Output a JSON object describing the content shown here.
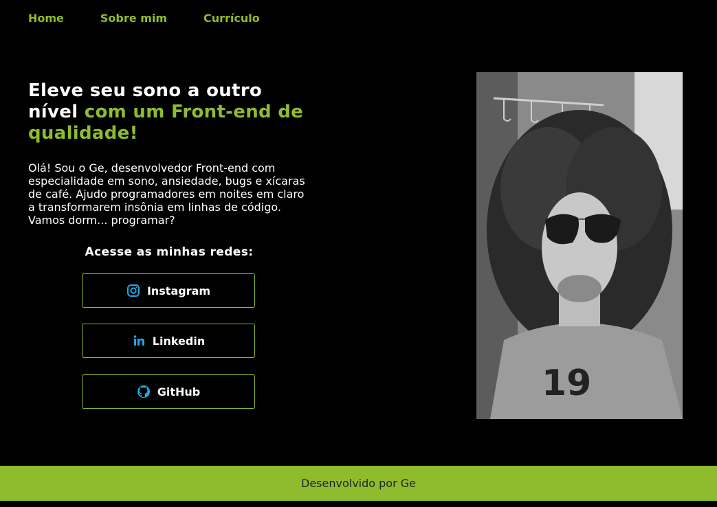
{
  "nav": {
    "items": [
      {
        "label": "Home"
      },
      {
        "label": "Sobre mim"
      },
      {
        "label": "Currículo"
      }
    ]
  },
  "hero": {
    "title_plain": "Eleve seu sono a outro nível ",
    "title_accent": "com um Front-end de qualidade!",
    "intro": "Olá! Sou o Ge, desenvolvedor Front-end com especialidade em sono, ansiedade, bugs e xícaras de café. Ajudo programadores em noites em claro a transformarem insônia em linhas de código. Vamos dorm... programar?"
  },
  "social": {
    "title": "Acesse as minhas redes:",
    "links": [
      {
        "label": "Instagram",
        "icon": "instagram-icon"
      },
      {
        "label": "Linkedin",
        "icon": "linkedin-icon"
      },
      {
        "label": "GitHub",
        "icon": "github-icon"
      }
    ]
  },
  "photo": {
    "alt": "profile-photo"
  },
  "footer": {
    "text": "Desenvolvido por Ge"
  },
  "colors": {
    "accent": "#8fbc2c",
    "icon": "#22a7e6",
    "background": "#000000"
  }
}
